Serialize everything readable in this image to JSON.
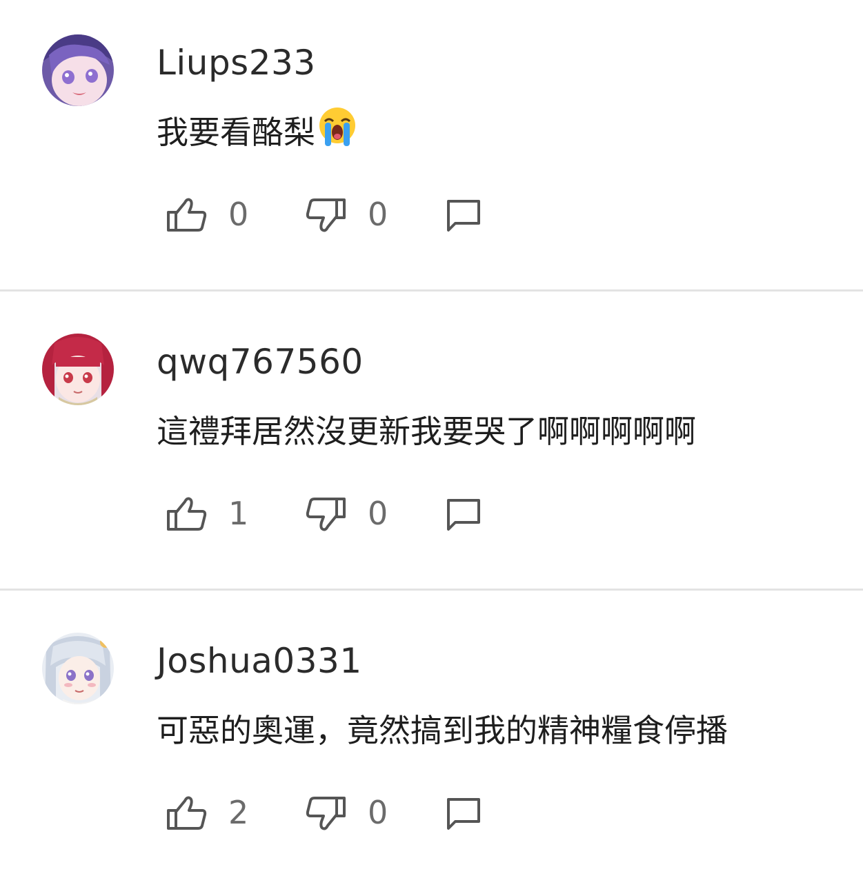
{
  "comments": [
    {
      "username": "Liups233",
      "text": "我要看酪梨",
      "emoji": "loudly-crying-face",
      "likes": "0",
      "dislikes": "0",
      "avatar": "purple-haired-anime-avatar"
    },
    {
      "username": "qwq767560",
      "text": "這禮拜居然沒更新我要哭了啊啊啊啊啊",
      "likes": "1",
      "dislikes": "0",
      "avatar": "red-haired-anime-avatar"
    },
    {
      "username": "Joshua0331",
      "text": "可惡的奧運，竟然搞到我的精神糧食停播",
      "likes": "2",
      "dislikes": "0",
      "avatar": "white-haired-anime-avatar"
    }
  ],
  "colors": {
    "icon": "#555555",
    "count": "#6b6b6b",
    "divider": "#e3e3e3"
  }
}
